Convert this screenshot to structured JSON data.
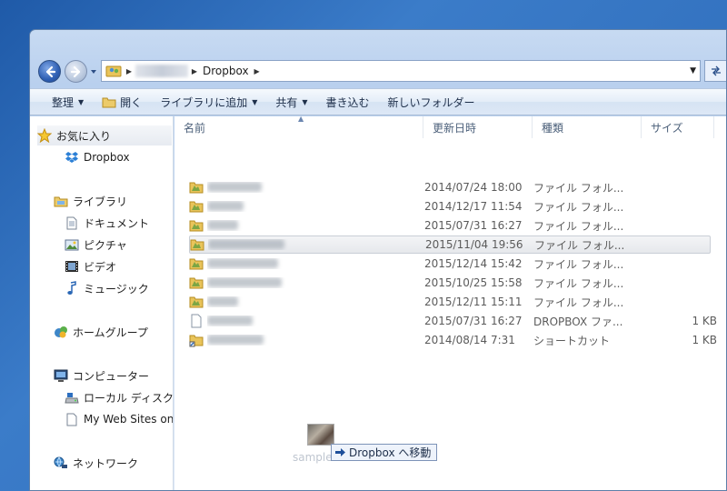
{
  "address": {
    "crumbs": [
      "Dropbox"
    ]
  },
  "toolbar": {
    "organize": "整理",
    "open": "開く",
    "add_library": "ライブラリに追加",
    "share": "共有",
    "burn": "書き込む",
    "new_folder": "新しいフォルダー"
  },
  "nav": {
    "favorites": "お気に入り",
    "dropbox": "Dropbox",
    "libraries": "ライブラリ",
    "documents": "ドキュメント",
    "pictures": "ピクチャ",
    "videos": "ビデオ",
    "music": "ミュージック",
    "homegroup": "ホームグループ",
    "computer": "コンピューター",
    "local_disk": "ローカル ディスク",
    "my_web_sites": "My Web Sites on",
    "network": "ネットワーク"
  },
  "columns": {
    "name": "名前",
    "date": "更新日時",
    "type": "種類",
    "size": "サイズ"
  },
  "files": [
    {
      "date": "2014/07/24 18:00",
      "type": "ファイル フォル...",
      "size": "",
      "kind": "folder"
    },
    {
      "date": "2014/12/17 11:54",
      "type": "ファイル フォル...",
      "size": "",
      "kind": "folder"
    },
    {
      "date": "2015/07/31 16:27",
      "type": "ファイル フォル...",
      "size": "",
      "kind": "folder"
    },
    {
      "date": "2015/11/04 19:56",
      "type": "ファイル フォル...",
      "size": "",
      "kind": "folder",
      "selected": true
    },
    {
      "date": "2015/12/14 15:42",
      "type": "ファイル フォル...",
      "size": "",
      "kind": "folder"
    },
    {
      "date": "2015/10/25 15:58",
      "type": "ファイル フォル...",
      "size": "",
      "kind": "folder"
    },
    {
      "date": "2015/12/11 15:11",
      "type": "ファイル フォル...",
      "size": "",
      "kind": "folder"
    },
    {
      "date": "2015/07/31 16:27",
      "type": "DROPBOX ファ...",
      "size": "1 KB",
      "kind": "file"
    },
    {
      "date": "2014/08/14 7:31",
      "type": "ショートカット",
      "size": "1 KB",
      "kind": "shortcut"
    }
  ],
  "drag": {
    "name": "sample",
    "tooltip": "Dropbox へ移動"
  }
}
